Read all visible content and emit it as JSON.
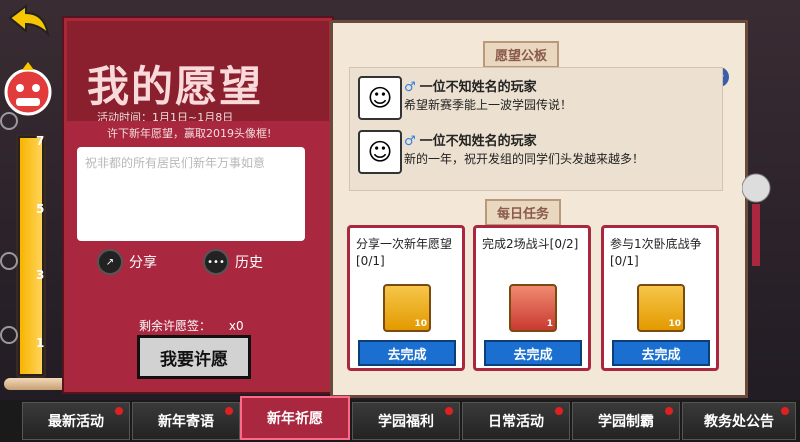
{
  "wish_panel": {
    "title": "我的愿望",
    "activity_time": "活动时间：1月1日~1月8日",
    "activity_desc": "许下新年愿望，赢取2019头像框!",
    "input_placeholder": "祝非都的所有居民们新年万事如意",
    "share_label": "分享",
    "history_label": "历史",
    "remaining_label": "剩余许愿签：",
    "remaining_count": "x0",
    "make_wish_label": "我要许愿"
  },
  "progress": {
    "ticks": [
      "7",
      "5",
      "3",
      "1"
    ],
    "fill_fraction": 1.0
  },
  "board": {
    "title": "愿望公板",
    "messages": [
      {
        "name": "一位不知姓名的玩家",
        "text": "希望新赛季能上一波学园传说！"
      },
      {
        "name": "一位不知姓名的玩家",
        "text": "新的一年，祝开发组的同学们头发越来越多！"
      }
    ]
  },
  "daily": {
    "title": "每日任务",
    "tasks": [
      {
        "text": "分享一次新年愿望[0/1]",
        "item_icon": "gold-bar-icon",
        "count": "10",
        "button": "去完成"
      },
      {
        "text": "完成2场战斗[0/2]",
        "item_icon": "scroll-icon",
        "count": "1",
        "button": "去完成"
      },
      {
        "text": "参与1次卧底战争[0/1]",
        "item_icon": "gold-bar-icon",
        "count": "10",
        "button": "去完成"
      }
    ]
  },
  "tabs": [
    {
      "label": "最新活动",
      "dot": true
    },
    {
      "label": "新年寄语",
      "dot": true
    },
    {
      "label": "新年祈愿",
      "dot": false,
      "active": true
    },
    {
      "label": "学园福利",
      "dot": true
    },
    {
      "label": "日常活动",
      "dot": true
    },
    {
      "label": "学园制霸",
      "dot": true
    },
    {
      "label": "教务处公告",
      "dot": true
    }
  ],
  "colors": {
    "accent_red": "#a92840",
    "gold": "#f7b500",
    "blue_button": "#1a6fd0"
  }
}
